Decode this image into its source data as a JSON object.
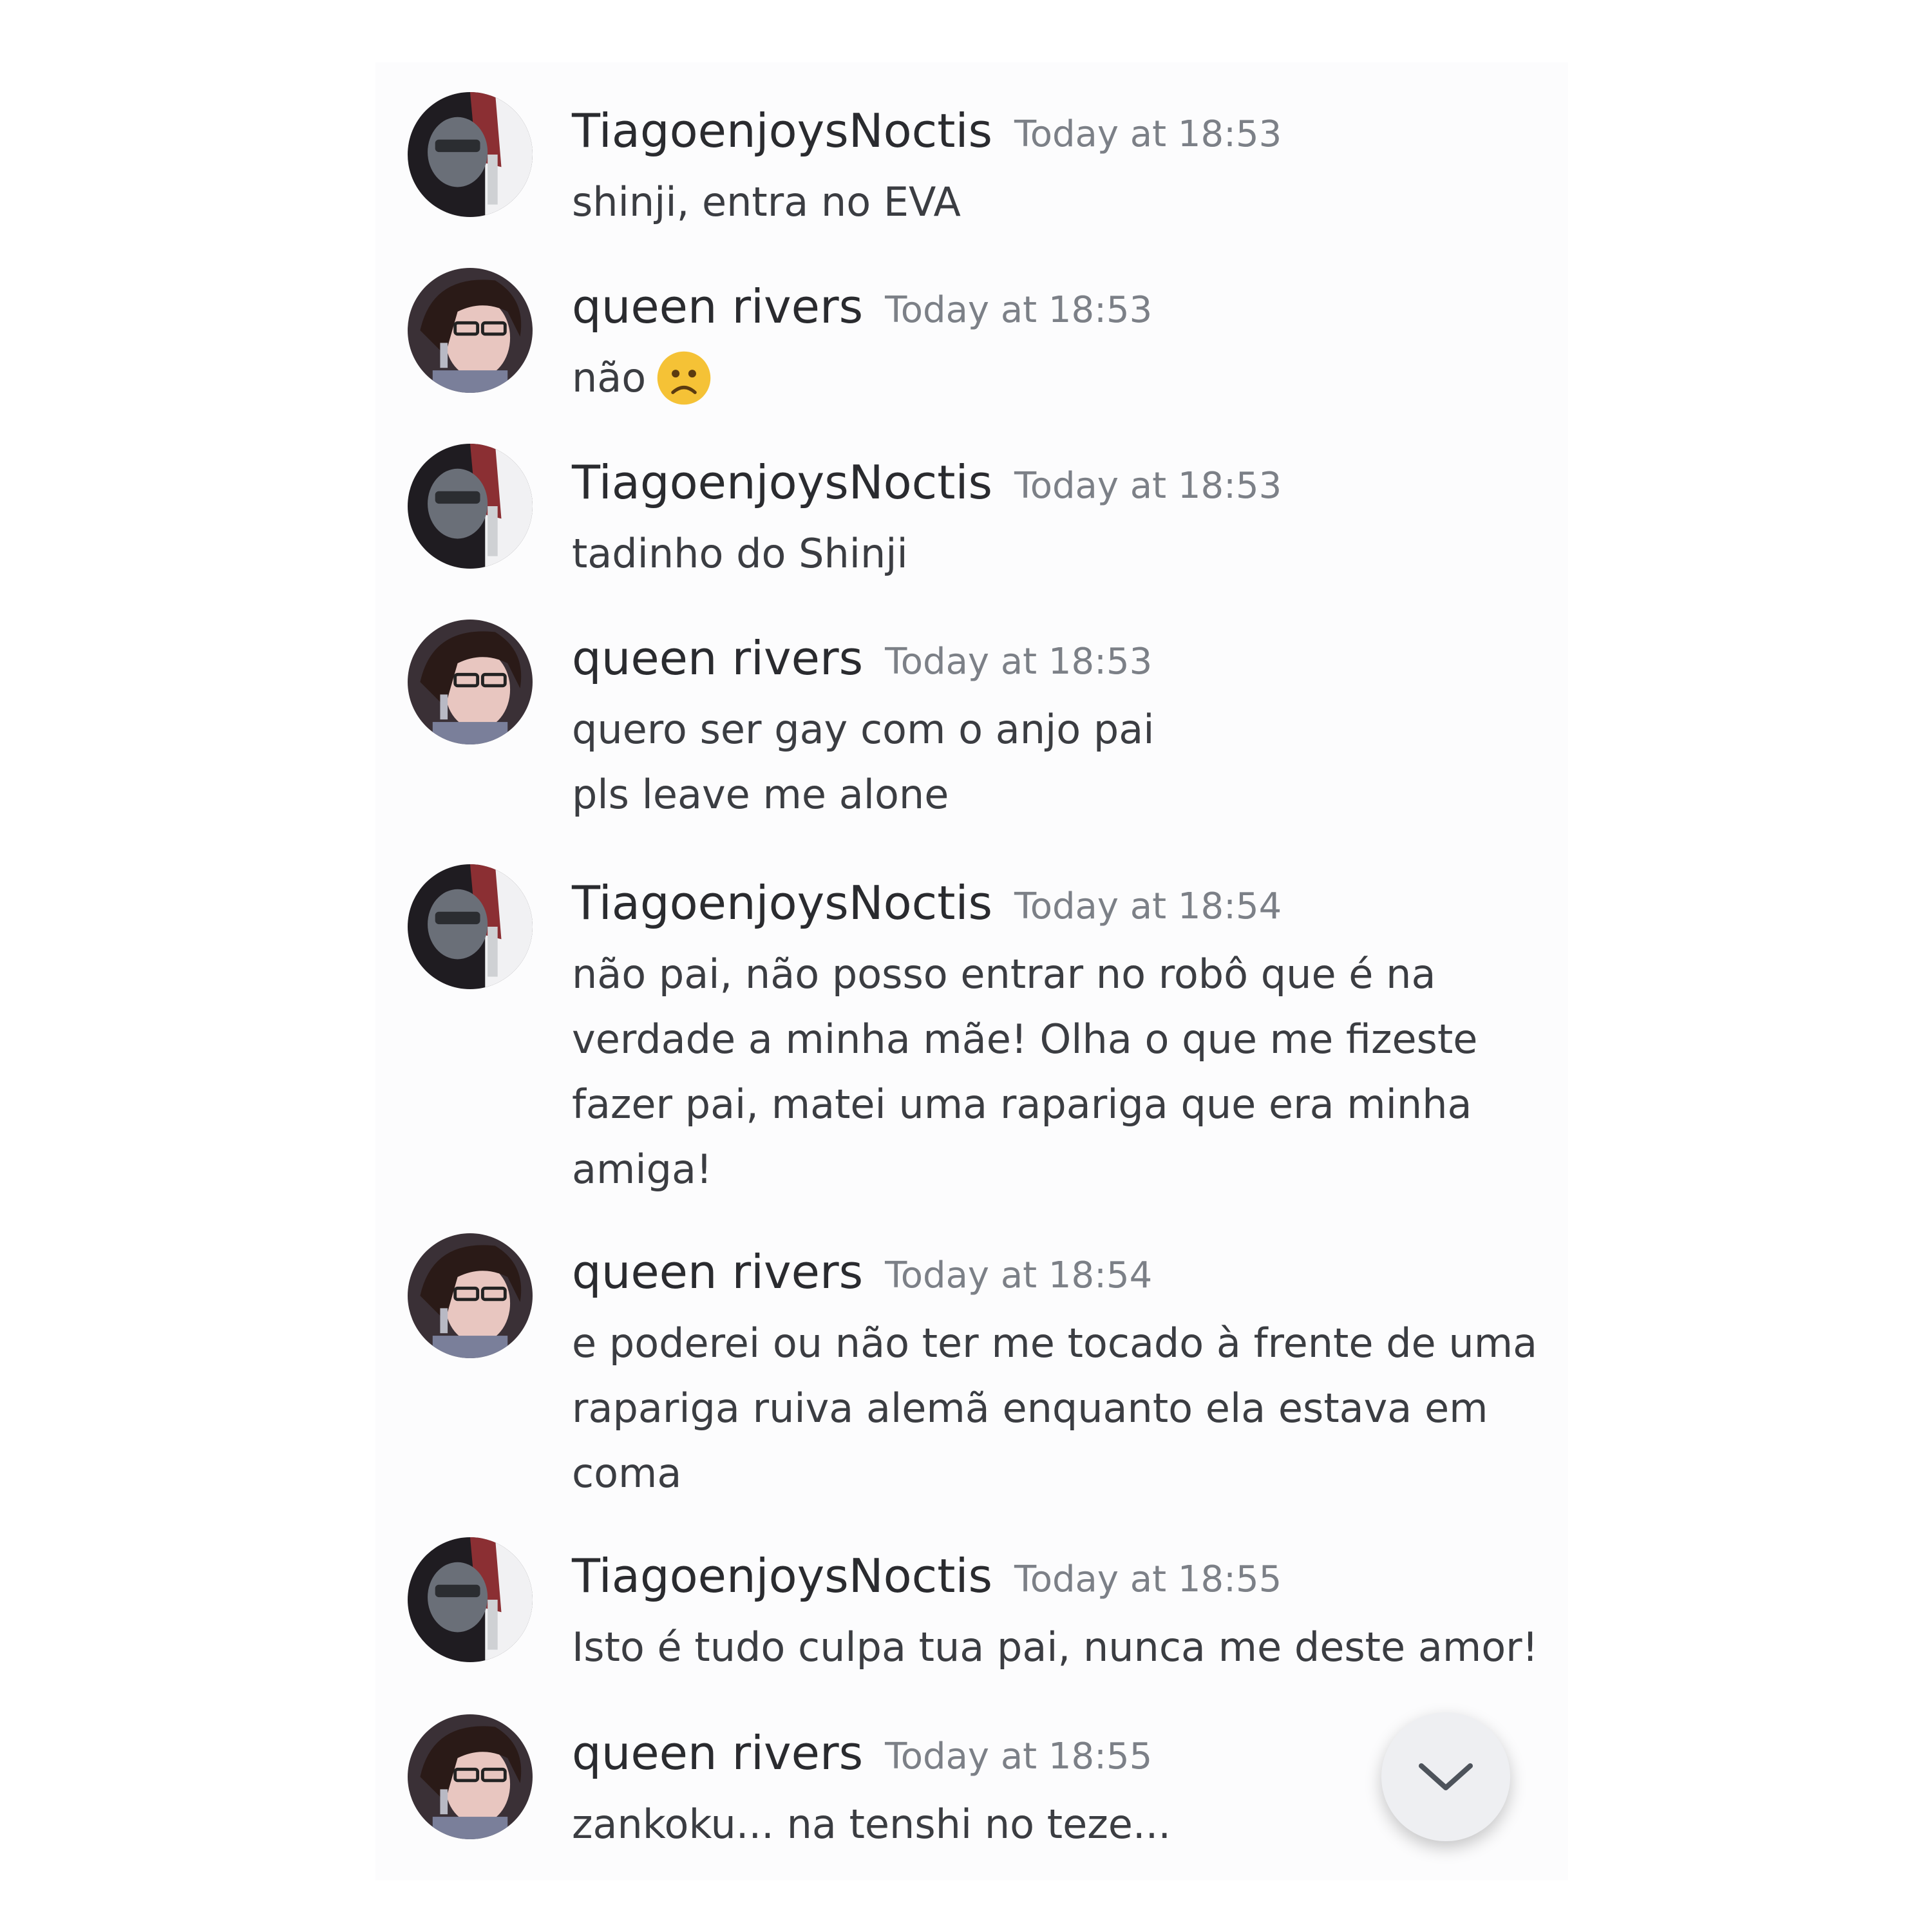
{
  "messages": [
    {
      "author": "TiagoenjoysNoctis",
      "avatar_icon": "tiago-avatar",
      "timestamp": "Today at 18:53",
      "lines": [
        "shinji, entra no EVA"
      ]
    },
    {
      "author": "queen rivers",
      "avatar_icon": "queen-avatar",
      "timestamp": "Today at 18:53",
      "lines": [
        "não"
      ],
      "emoji": "frowning-face-emoji"
    },
    {
      "author": "TiagoenjoysNoctis",
      "avatar_icon": "tiago-avatar",
      "timestamp": "Today at 18:53",
      "lines": [
        "tadinho do Shinji"
      ]
    },
    {
      "author": "queen rivers",
      "avatar_icon": "queen-avatar",
      "timestamp": "Today at 18:53",
      "lines": [
        "quero ser gay com o anjo pai",
        "pls leave me alone"
      ]
    },
    {
      "author": "TiagoenjoysNoctis",
      "avatar_icon": "tiago-avatar",
      "timestamp": "Today at 18:54",
      "lines": [
        "não pai, não posso entrar no robô que é na",
        "verdade a minha mãe! Olha o que me fizeste",
        "fazer pai, matei uma rapariga que era minha",
        "amiga!"
      ]
    },
    {
      "author": "queen rivers",
      "avatar_icon": "queen-avatar",
      "timestamp": "Today at 18:54",
      "lines": [
        "e poderei ou não ter me tocado à frente de uma",
        "rapariga ruiva alemã enquanto ela estava em",
        "coma"
      ]
    },
    {
      "author": "TiagoenjoysNoctis",
      "avatar_icon": "tiago-avatar",
      "timestamp": "Today at 18:55",
      "lines": [
        "Isto é tudo culpa tua pai, nunca me deste amor!"
      ]
    },
    {
      "author": "queen rivers",
      "avatar_icon": "queen-avatar",
      "timestamp": "Today at 18:55",
      "lines": [
        "zankoku... na tenshi no teze..."
      ]
    }
  ],
  "scroll_button": {
    "icon": "chevron-down-icon"
  },
  "colors": {
    "username": "#2a2b2f",
    "timestamp": "#7c8087",
    "message_text": "#3b3d42",
    "panel_background": "#fcfcfd"
  }
}
